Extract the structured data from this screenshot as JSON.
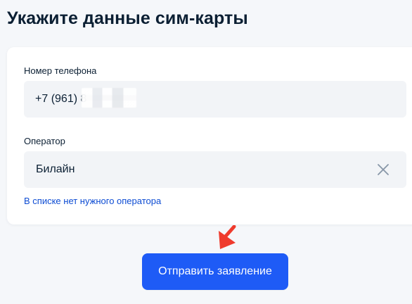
{
  "page": {
    "title": "Укажите данные сим-карты"
  },
  "form": {
    "phone": {
      "label": "Номер телефона",
      "value": "+7 (961) 8"
    },
    "operator": {
      "label": "Оператор",
      "value": "Билайн",
      "clear_icon": "close-icon"
    },
    "missing_operator_link": "В списке нет нужного оператора"
  },
  "actions": {
    "submit_label": "Отправить заявление"
  },
  "colors": {
    "background": "#f5f7fa",
    "card": "#ffffff",
    "input_background": "#f2f4f7",
    "text": "#0b1f33",
    "link": "#0d4cd3",
    "button": "#1e5bf6",
    "annotation_arrow": "#ef3b2d"
  }
}
